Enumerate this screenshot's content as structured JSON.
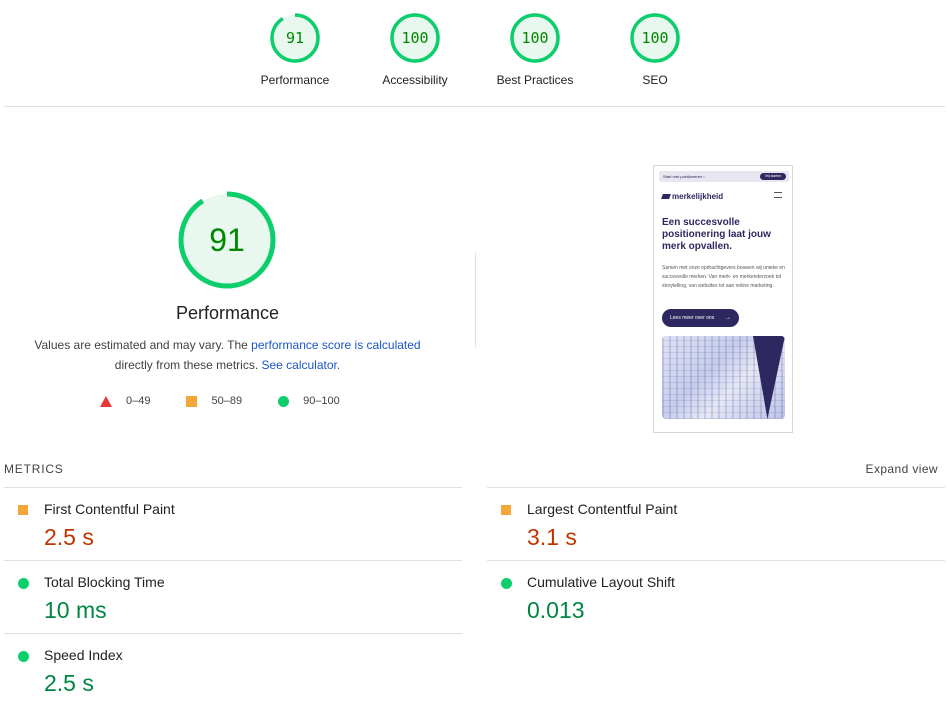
{
  "top_gauges": [
    {
      "score": "91",
      "label": "Performance"
    },
    {
      "score": "100",
      "label": "Accessibility"
    },
    {
      "score": "100",
      "label": "Best Practices"
    },
    {
      "score": "100",
      "label": "SEO"
    }
  ],
  "main_gauge": {
    "score": "91",
    "title": "Performance"
  },
  "description": {
    "part1": "Values are estimated and may vary. The ",
    "link1": "performance score is calculated",
    "part2": "directly from these metrics. ",
    "link2": "See calculator."
  },
  "legend": [
    {
      "range": "0–49",
      "color": "#e53935",
      "shape": "triangle"
    },
    {
      "range": "50–89",
      "color": "#f4a63a",
      "shape": "square"
    },
    {
      "range": "90–100",
      "color": "#0cce6b",
      "shape": "circle"
    }
  ],
  "thumbnail": {
    "banner_text": "Start met positioneren ›",
    "banner_button": "Vrij starten",
    "brand": "merkelijkheid",
    "headline": "Een succesvolle positionering laat jouw merk opvallen.",
    "body": "Samen met onze opdrachtgevers bouwen wij unieke en succesvolle merken. Van merk- en merkenderzoek tot storytelling, van websites tot aan online marketing.",
    "cta": "Lees meer over ons"
  },
  "metrics_section": {
    "title": "METRICS",
    "expand_label": "Expand view"
  },
  "metrics": [
    {
      "name": "First Contentful Paint",
      "value": "2.5 s",
      "status": "average",
      "color": "#c33300"
    },
    {
      "name": "Largest Contentful Paint",
      "value": "3.1 s",
      "status": "average",
      "color": "#c33300"
    },
    {
      "name": "Total Blocking Time",
      "value": "10 ms",
      "status": "good",
      "color": "#018642"
    },
    {
      "name": "Cumulative Layout Shift",
      "value": "0.013",
      "status": "good",
      "color": "#018642"
    },
    {
      "name": "Speed Index",
      "value": "2.5 s",
      "status": "good",
      "color": "#018642"
    }
  ],
  "colors": {
    "good_ring": "#0cce6b",
    "good_fill": "#e9f8ee",
    "score_text": "#008800",
    "link": "#1a56c8"
  }
}
